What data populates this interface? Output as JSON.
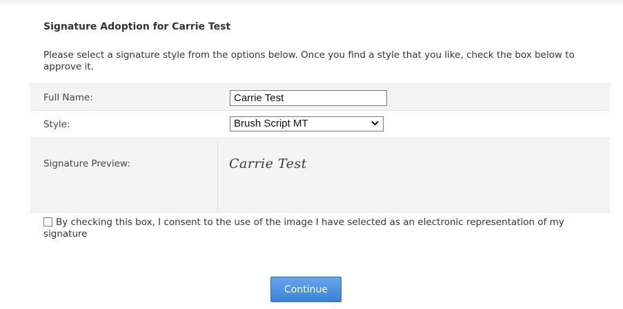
{
  "header": {
    "title": "Signature Adoption for Carrie Test",
    "intro": "Please select a signature style from the options below. Once you find a style that you like, check the box below to approve it."
  },
  "form": {
    "full_name_label": "Full Name:",
    "full_name_value": "Carrie Test",
    "style_label": "Style:",
    "style_value": "Brush Script MT",
    "preview_label": "Signature Preview:",
    "preview_text": "Carrie Test"
  },
  "consent": {
    "checked": false,
    "text": "By checking this box, I consent to the use of the image I have selected as an electronic representation of my signature"
  },
  "actions": {
    "continue_label": "Continue"
  },
  "colors": {
    "accent": "#3a82d6",
    "row_shade": "#f4f4f4"
  },
  "icons": {
    "style_dropdown": "chevron-down-icon",
    "consent_box": "checkbox-icon"
  }
}
